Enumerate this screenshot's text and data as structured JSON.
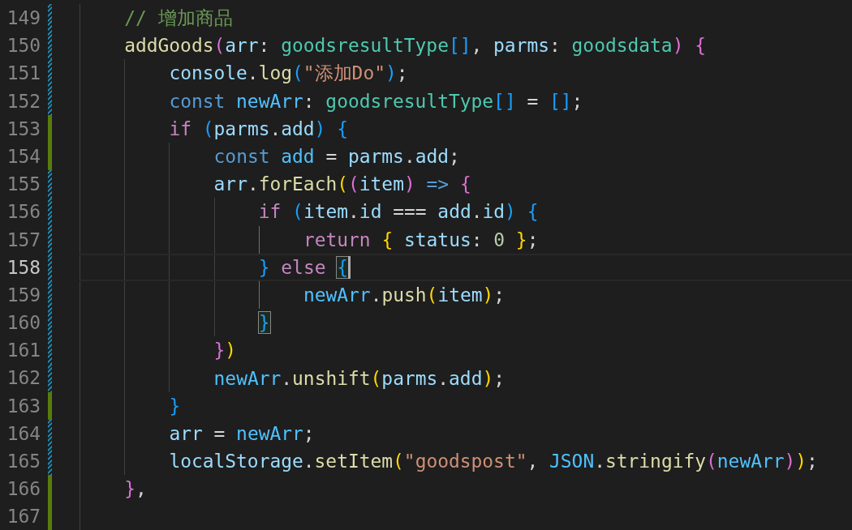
{
  "editor": {
    "lines": [
      {
        "number": "149",
        "kind": "modified",
        "current": false,
        "active_guide": false,
        "tokens": [
          {
            "color": "#6a9955",
            "text": "// 增加商品"
          }
        ]
      },
      {
        "number": "150",
        "kind": "modified",
        "current": false,
        "active_guide": false,
        "tokens": [
          {
            "color": "#dcdcaa",
            "text": "addGoods"
          },
          {
            "color": "#da70d6",
            "text": "("
          },
          {
            "color": "#9cdcfe",
            "text": "arr"
          },
          {
            "color": "#d4d4d4",
            "text": ": "
          },
          {
            "color": "#4ec9b0",
            "text": "goodsresultType"
          },
          {
            "color": "#179fff",
            "text": "[]"
          },
          {
            "color": "#d4d4d4",
            "text": ", "
          },
          {
            "color": "#9cdcfe",
            "text": "parms"
          },
          {
            "color": "#d4d4d4",
            "text": ": "
          },
          {
            "color": "#4ec9b0",
            "text": "goodsdata"
          },
          {
            "color": "#da70d6",
            "text": ") {"
          }
        ],
        "children": [
          {
            "number": "151",
            "kind": "modified",
            "current": false,
            "active_guide": false,
            "tokens": [
              {
                "color": "#9cdcfe",
                "text": "console"
              },
              {
                "color": "#d4d4d4",
                "text": "."
              },
              {
                "color": "#dcdcaa",
                "text": "log"
              },
              {
                "color": "#179fff",
                "text": "("
              },
              {
                "color": "#ce9178",
                "text": "\"添加Do\""
              },
              {
                "color": "#179fff",
                "text": ")"
              },
              {
                "color": "#d4d4d4",
                "text": ";"
              }
            ]
          },
          {
            "number": "152",
            "kind": "modified",
            "current": false,
            "active_guide": false,
            "tokens": [
              {
                "color": "#569cd6",
                "text": "const "
              },
              {
                "color": "#4fc1ff",
                "text": "newArr"
              },
              {
                "color": "#d4d4d4",
                "text": ": "
              },
              {
                "color": "#4ec9b0",
                "text": "goodsresultType"
              },
              {
                "color": "#179fff",
                "text": "[]"
              },
              {
                "color": "#d4d4d4",
                "text": " = "
              },
              {
                "color": "#179fff",
                "text": "[]"
              },
              {
                "color": "#d4d4d4",
                "text": ";"
              }
            ]
          },
          {
            "number": "153",
            "kind": "added",
            "current": false,
            "active_guide": false,
            "tokens": [
              {
                "color": "#c586c0",
                "text": "if "
              },
              {
                "color": "#179fff",
                "text": "("
              },
              {
                "color": "#9cdcfe",
                "text": "parms"
              },
              {
                "color": "#d4d4d4",
                "text": "."
              },
              {
                "color": "#9cdcfe",
                "text": "add"
              },
              {
                "color": "#179fff",
                "text": ") {"
              }
            ],
            "children": [
              {
                "number": "154",
                "kind": "added",
                "current": false,
                "active_guide": false,
                "tokens": [
                  {
                    "color": "#569cd6",
                    "text": "const "
                  },
                  {
                    "color": "#4fc1ff",
                    "text": "add"
                  },
                  {
                    "color": "#d4d4d4",
                    "text": " = "
                  },
                  {
                    "color": "#9cdcfe",
                    "text": "parms"
                  },
                  {
                    "color": "#d4d4d4",
                    "text": "."
                  },
                  {
                    "color": "#9cdcfe",
                    "text": "add"
                  },
                  {
                    "color": "#d4d4d4",
                    "text": ";"
                  }
                ]
              },
              {
                "number": "155",
                "kind": "modified",
                "current": false,
                "active_guide": false,
                "tokens": [
                  {
                    "color": "#9cdcfe",
                    "text": "arr"
                  },
                  {
                    "color": "#d4d4d4",
                    "text": "."
                  },
                  {
                    "color": "#dcdcaa",
                    "text": "forEach"
                  },
                  {
                    "color": "#ffd700",
                    "text": "("
                  },
                  {
                    "color": "#da70d6",
                    "text": "("
                  },
                  {
                    "color": "#9cdcfe",
                    "text": "item"
                  },
                  {
                    "color": "#da70d6",
                    "text": ") "
                  },
                  {
                    "color": "#569cd6",
                    "text": "=> "
                  },
                  {
                    "color": "#da70d6",
                    "text": "{"
                  }
                ],
                "children": [
                  {
                    "number": "156",
                    "kind": "modified",
                    "current": false,
                    "active_guide": false,
                    "tokens": [
                      {
                        "color": "#c586c0",
                        "text": "if "
                      },
                      {
                        "color": "#179fff",
                        "text": "("
                      },
                      {
                        "color": "#9cdcfe",
                        "text": "item"
                      },
                      {
                        "color": "#d4d4d4",
                        "text": "."
                      },
                      {
                        "color": "#9cdcfe",
                        "text": "id"
                      },
                      {
                        "color": "#d4d4d4",
                        "text": " === "
                      },
                      {
                        "color": "#9cdcfe",
                        "text": "add"
                      },
                      {
                        "color": "#d4d4d4",
                        "text": "."
                      },
                      {
                        "color": "#9cdcfe",
                        "text": "id"
                      },
                      {
                        "color": "#179fff",
                        "text": ") {"
                      }
                    ],
                    "children": [
                      {
                        "number": "157",
                        "kind": "modified",
                        "current": false,
                        "active_guide": true,
                        "tokens": [
                          {
                            "color": "#c586c0",
                            "text": "return "
                          },
                          {
                            "color": "#ffd700",
                            "text": "{ "
                          },
                          {
                            "color": "#9cdcfe",
                            "text": "status"
                          },
                          {
                            "color": "#d4d4d4",
                            "text": ": "
                          },
                          {
                            "color": "#b5cea8",
                            "text": "0 "
                          },
                          {
                            "color": "#ffd700",
                            "text": "}"
                          },
                          {
                            "color": "#d4d4d4",
                            "text": ";"
                          }
                        ]
                      }
                    ]
                  },
                  {
                    "number": "158",
                    "kind": "modified",
                    "current": true,
                    "active_guide": false,
                    "cursor": true,
                    "tokens": [
                      {
                        "color": "#179fff",
                        "text": "} "
                      },
                      {
                        "color": "#c586c0",
                        "text": "else "
                      },
                      {
                        "color": "#179fff",
                        "text": "{",
                        "match": true
                      }
                    ],
                    "children": [
                      {
                        "number": "159",
                        "kind": "modified",
                        "current": false,
                        "active_guide": true,
                        "tokens": [
                          {
                            "color": "#4fc1ff",
                            "text": "newArr"
                          },
                          {
                            "color": "#d4d4d4",
                            "text": "."
                          },
                          {
                            "color": "#dcdcaa",
                            "text": "push"
                          },
                          {
                            "color": "#ffd700",
                            "text": "("
                          },
                          {
                            "color": "#9cdcfe",
                            "text": "item"
                          },
                          {
                            "color": "#ffd700",
                            "text": ")"
                          },
                          {
                            "color": "#d4d4d4",
                            "text": ";"
                          }
                        ]
                      }
                    ]
                  },
                  {
                    "number": "160",
                    "kind": "modified",
                    "current": false,
                    "active_guide": false,
                    "tokens": [
                      {
                        "color": "#179fff",
                        "text": "}",
                        "match": true
                      }
                    ]
                  }
                ]
              },
              {
                "number": "161",
                "kind": "modified",
                "current": false,
                "active_guide": false,
                "tokens": [
                  {
                    "color": "#da70d6",
                    "text": "}"
                  },
                  {
                    "color": "#ffd700",
                    "text": ")"
                  }
                ]
              },
              {
                "number": "162",
                "kind": "modified",
                "current": false,
                "active_guide": false,
                "tokens": [
                  {
                    "color": "#4fc1ff",
                    "text": "newArr"
                  },
                  {
                    "color": "#d4d4d4",
                    "text": "."
                  },
                  {
                    "color": "#dcdcaa",
                    "text": "unshift"
                  },
                  {
                    "color": "#ffd700",
                    "text": "("
                  },
                  {
                    "color": "#9cdcfe",
                    "text": "parms"
                  },
                  {
                    "color": "#d4d4d4",
                    "text": "."
                  },
                  {
                    "color": "#9cdcfe",
                    "text": "add"
                  },
                  {
                    "color": "#ffd700",
                    "text": ")"
                  },
                  {
                    "color": "#d4d4d4",
                    "text": ";"
                  }
                ]
              }
            ]
          },
          {
            "number": "163",
            "kind": "added",
            "current": false,
            "active_guide": false,
            "tokens": [
              {
                "color": "#179fff",
                "text": "}"
              }
            ]
          },
          {
            "number": "164",
            "kind": "modified",
            "current": false,
            "active_guide": false,
            "tokens": [
              {
                "color": "#9cdcfe",
                "text": "arr"
              },
              {
                "color": "#d4d4d4",
                "text": " = "
              },
              {
                "color": "#4fc1ff",
                "text": "newArr"
              },
              {
                "color": "#d4d4d4",
                "text": ";"
              }
            ]
          },
          {
            "number": "165",
            "kind": "modified",
            "current": false,
            "active_guide": false,
            "tokens": [
              {
                "color": "#9cdcfe",
                "text": "localStorage"
              },
              {
                "color": "#d4d4d4",
                "text": "."
              },
              {
                "color": "#dcdcaa",
                "text": "setItem"
              },
              {
                "color": "#ffd700",
                "text": "("
              },
              {
                "color": "#ce9178",
                "text": "\"goodspost\""
              },
              {
                "color": "#d4d4d4",
                "text": ", "
              },
              {
                "color": "#4fc1ff",
                "text": "JSON"
              },
              {
                "color": "#d4d4d4",
                "text": "."
              },
              {
                "color": "#dcdcaa",
                "text": "stringify"
              },
              {
                "color": "#da70d6",
                "text": "("
              },
              {
                "color": "#4fc1ff",
                "text": "newArr"
              },
              {
                "color": "#da70d6",
                "text": ")"
              },
              {
                "color": "#ffd700",
                "text": ")"
              },
              {
                "color": "#d4d4d4",
                "text": ";"
              }
            ]
          }
        ]
      },
      {
        "number": "166",
        "kind": "added",
        "current": false,
        "active_guide": false,
        "tokens": [
          {
            "color": "#da70d6",
            "text": "}"
          },
          {
            "color": "#d4d4d4",
            "text": ","
          }
        ]
      },
      {
        "number": "167",
        "kind": "added",
        "current": false,
        "active_guide": false
      }
    ]
  }
}
